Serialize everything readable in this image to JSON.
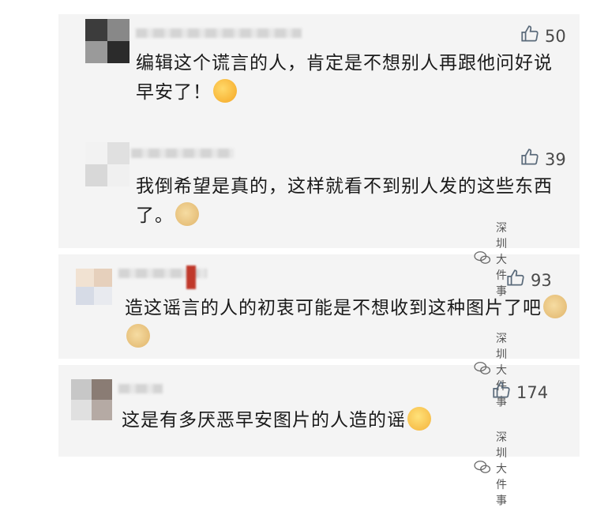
{
  "comments": [
    {
      "likes": "50",
      "text": "编辑这个谎言的人，肯定是不想别人再跟他问好说早安了！",
      "emoji": "facepalm-cry-emoji"
    },
    {
      "likes": "39",
      "text": "我倒希望是真的，这样就看不到别人发的这些东西了。",
      "emoji": "doge-emoji",
      "watermark": "深圳大件事"
    },
    {
      "likes": "93",
      "text": "造这谣言的人的初衷可能是不想收到这种图片了吧",
      "emoji": "doge-emoji",
      "watermark": "深圳大件事"
    },
    {
      "likes": "174",
      "text": "这是有多厌恶早安图片的人造的谣",
      "emoji": "sweat-smile-emoji",
      "watermark": "深圳大件事"
    }
  ]
}
